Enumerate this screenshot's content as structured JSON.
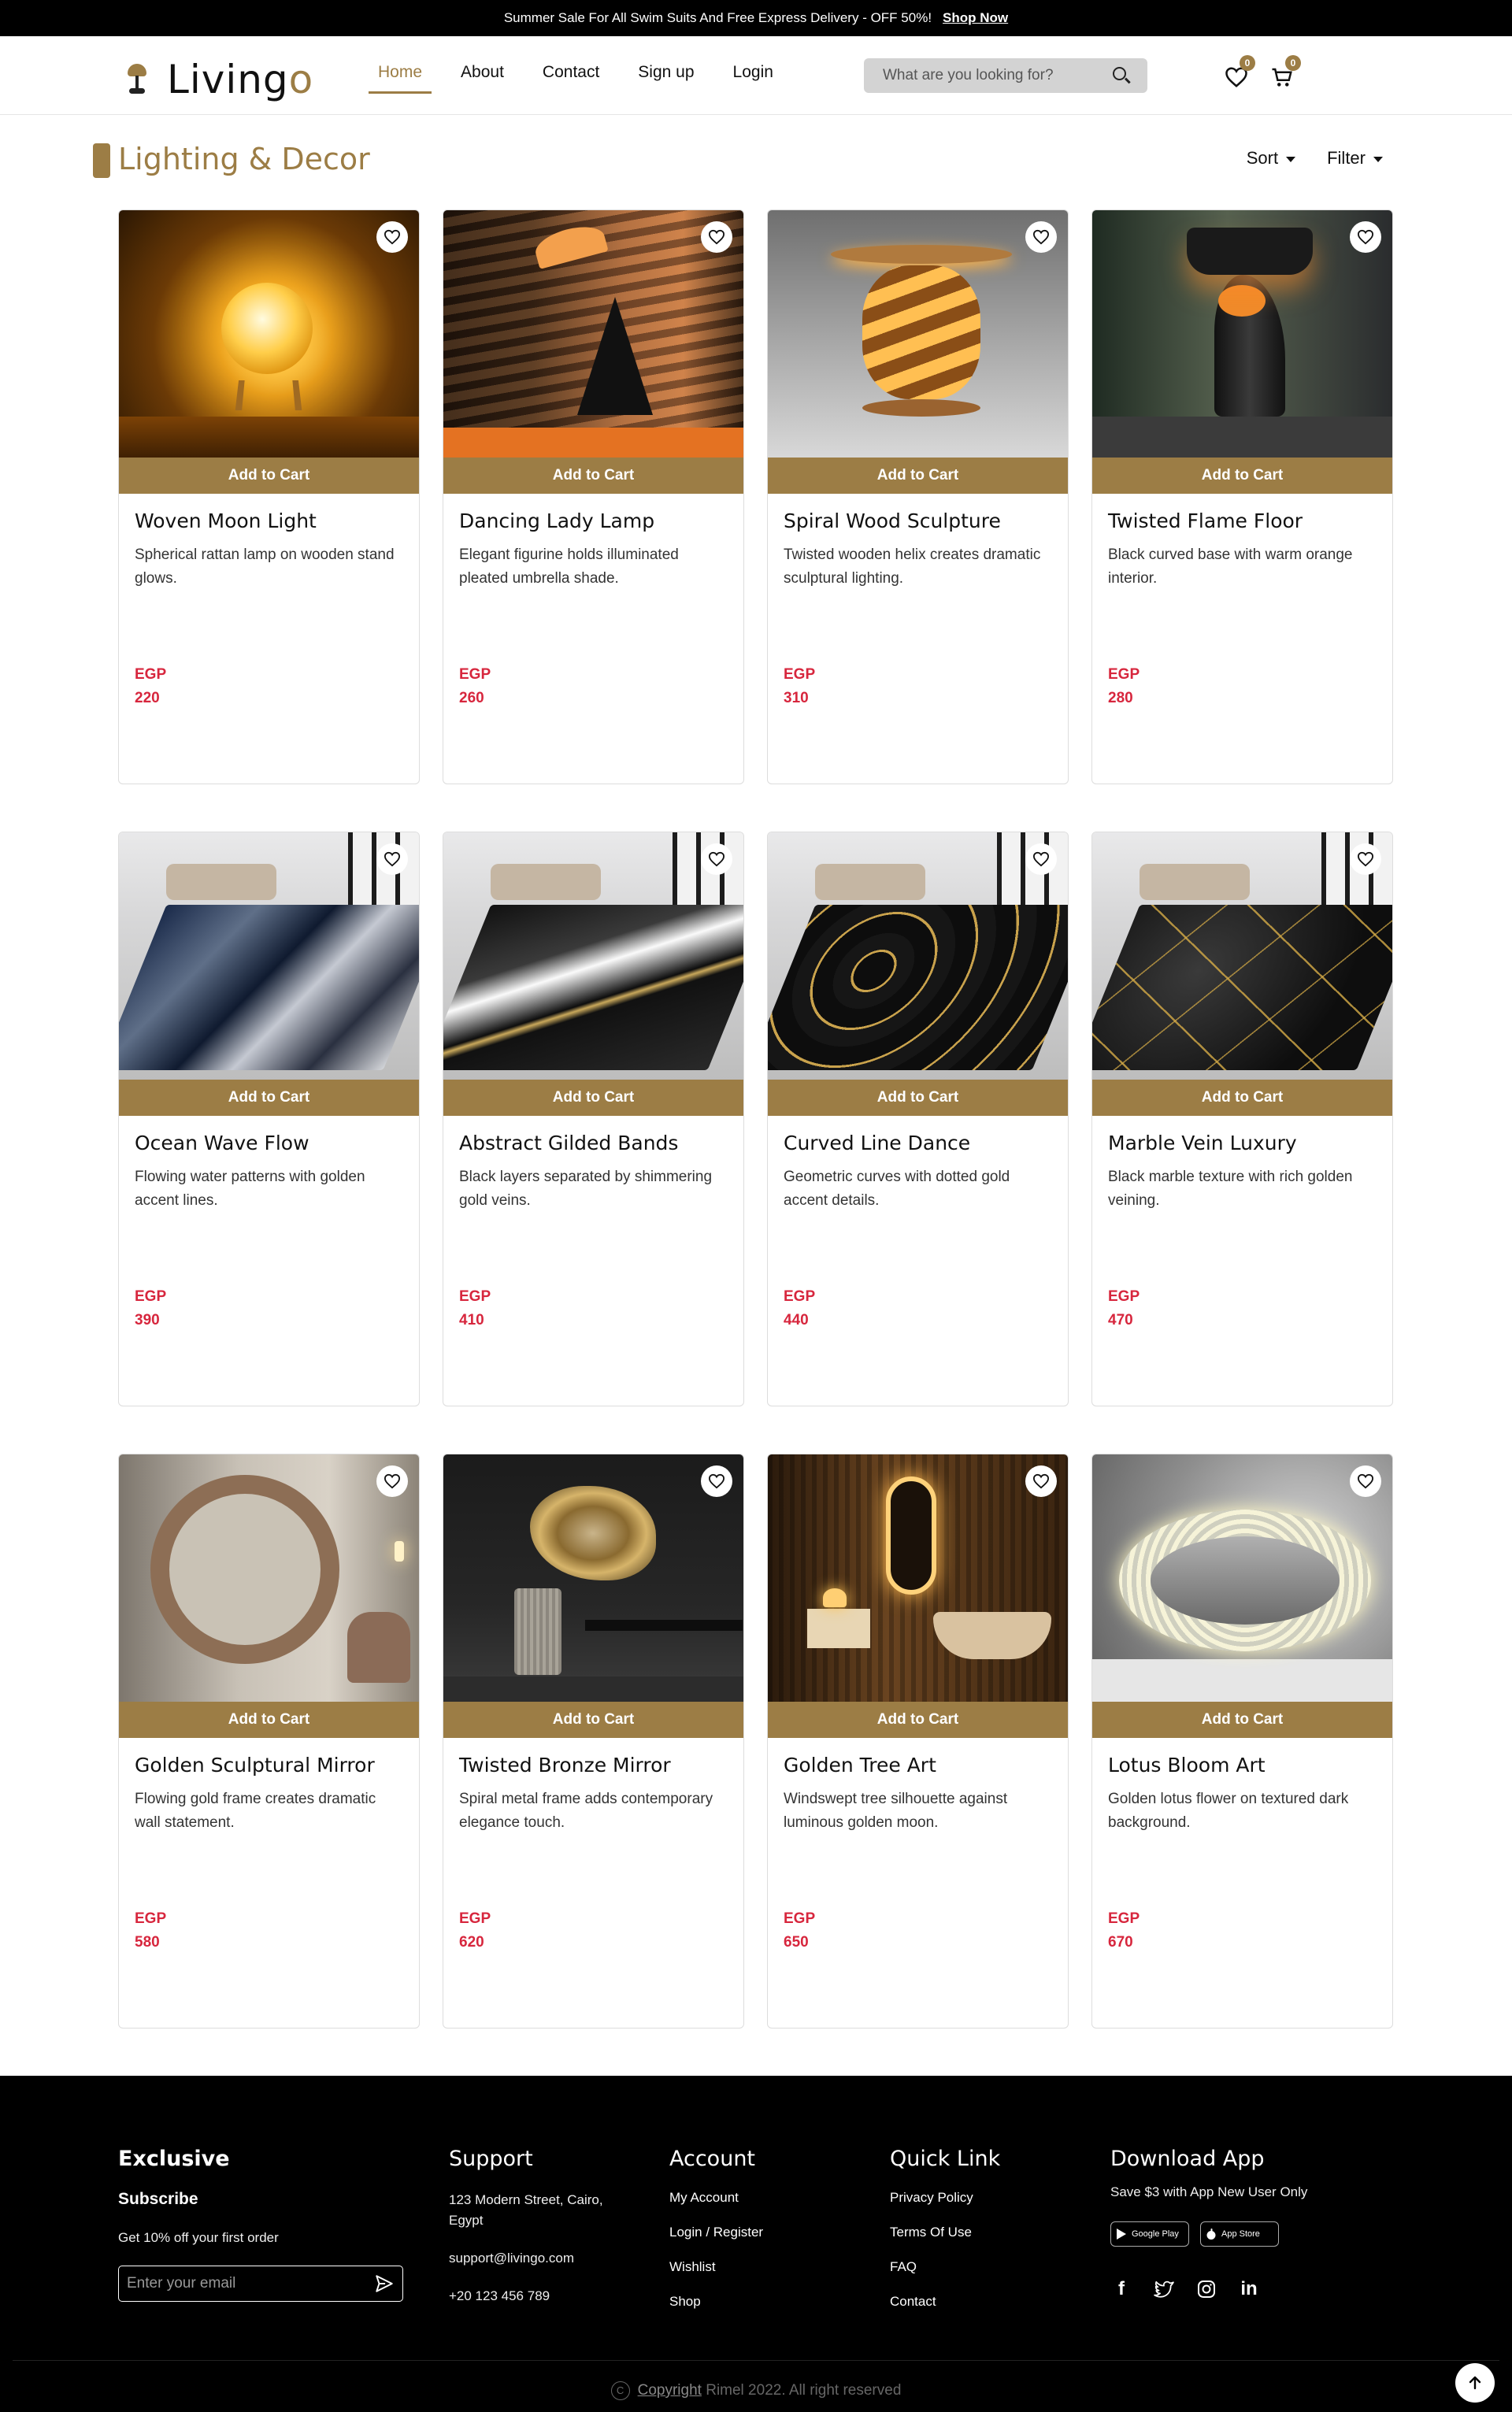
{
  "topbar": {
    "message": "Summer Sale For All Swim Suits And Free Express Delivery - OFF 50%!",
    "cta": "Shop Now"
  },
  "header": {
    "brand_main": "Living",
    "brand_accent": "o",
    "nav": [
      "Home",
      "About",
      "Contact",
      "Sign up",
      "Login"
    ],
    "active_nav": "Home",
    "search_placeholder": "What are you looking for?",
    "wishlist_count": "0",
    "cart_count": "0"
  },
  "page": {
    "title": "Lighting & Decor",
    "sort_label": "Sort",
    "filter_label": "Filter"
  },
  "products": [
    {
      "name": "Woven Moon Light",
      "desc": "Spherical rattan lamp on wooden stand glows.",
      "currency": "EGP",
      "price": "220",
      "add_label": "Add to Cart"
    },
    {
      "name": "Dancing Lady Lamp",
      "desc": "Elegant figurine holds illuminated pleated umbrella shade.",
      "currency": "EGP",
      "price": "260",
      "add_label": "Add to Cart"
    },
    {
      "name": "Spiral Wood Sculpture",
      "desc": "Twisted wooden helix creates dramatic sculptural lighting.",
      "currency": "EGP",
      "price": "310",
      "add_label": "Add to Cart"
    },
    {
      "name": "Twisted Flame Floor",
      "desc": "Black curved base with warm orange interior.",
      "currency": "EGP",
      "price": "280",
      "add_label": "Add to Cart"
    },
    {
      "name": "Ocean Wave Flow",
      "desc": "Flowing water patterns with golden accent lines.",
      "currency": "EGP",
      "price": "390",
      "add_label": "Add to Cart"
    },
    {
      "name": "Abstract Gilded Bands",
      "desc": "Black layers separated by shimmering gold veins.",
      "currency": "EGP",
      "price": "410",
      "add_label": "Add to Cart"
    },
    {
      "name": "Curved Line Dance",
      "desc": "Geometric curves with dotted gold accent details.",
      "currency": "EGP",
      "price": "440",
      "add_label": "Add to Cart"
    },
    {
      "name": "Marble Vein Luxury",
      "desc": "Black marble texture with rich golden veining.",
      "currency": "EGP",
      "price": "470",
      "add_label": "Add to Cart"
    },
    {
      "name": "Golden Sculptural Mirror",
      "desc": "Flowing gold frame creates dramatic wall statement.",
      "currency": "EGP",
      "price": "580",
      "add_label": "Add to Cart"
    },
    {
      "name": "Twisted Bronze Mirror",
      "desc": "Spiral metal frame adds contemporary elegance touch.",
      "currency": "EGP",
      "price": "620",
      "add_label": "Add to Cart"
    },
    {
      "name": "Golden Tree Art",
      "desc": "Windswept tree silhouette against luminous golden moon.",
      "currency": "EGP",
      "price": "650",
      "add_label": "Add to Cart"
    },
    {
      "name": "Lotus Bloom Art",
      "desc": "Golden lotus flower on textured dark background.",
      "currency": "EGP",
      "price": "670",
      "add_label": "Add to Cart"
    }
  ],
  "footer": {
    "exclusive": {
      "title": "Exclusive",
      "subtitle": "Subscribe",
      "text": "Get 10% off your first order",
      "email_placeholder": "Enter your email"
    },
    "support": {
      "title": "Support",
      "address": "123 Modern Street, Cairo, Egypt",
      "email": "support@livingo.com",
      "phone": "+20 123 456 789"
    },
    "account": {
      "title": "Account",
      "links": [
        "My Account",
        "Login / Register",
        "Wishlist",
        "Shop"
      ]
    },
    "quick": {
      "title": "Quick Link",
      "links": [
        "Privacy Policy",
        "Terms Of Use",
        "FAQ",
        "Contact"
      ]
    },
    "app": {
      "title": "Download App",
      "text": "Save $3 with App New User Only",
      "google_play": "Google Play",
      "app_store": "App Store"
    },
    "copyright_link": "Copyright",
    "copyright_text": "Rimel 2022. All right reserved"
  },
  "colors": {
    "accent": "#9c7d45",
    "price": "#d7263d",
    "footer_bg": "#000000"
  }
}
